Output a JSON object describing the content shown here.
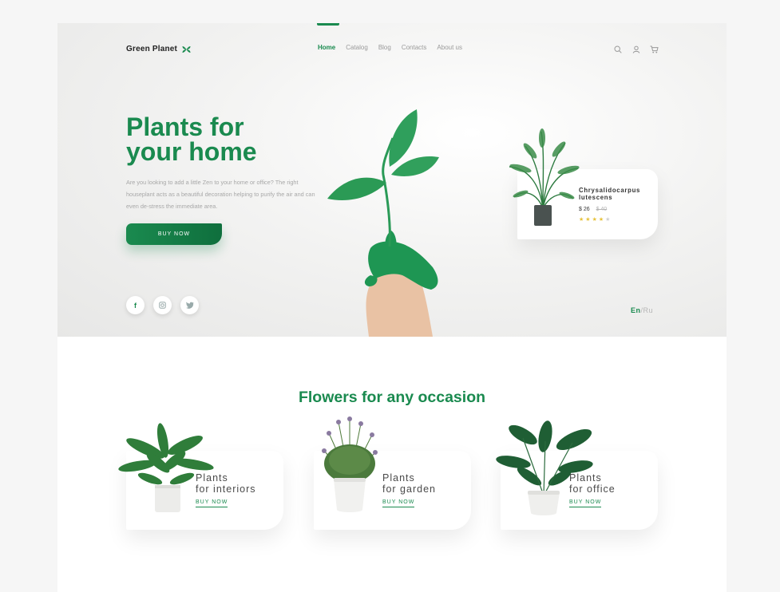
{
  "brand": {
    "name": "Green Planet",
    "accent": "#1a8a4f"
  },
  "nav": {
    "items": [
      {
        "label": "Home",
        "active": true
      },
      {
        "label": "Catalog",
        "active": false
      },
      {
        "label": "Blog",
        "active": false
      },
      {
        "label": "Contacts",
        "active": false
      },
      {
        "label": "About us",
        "active": false
      }
    ]
  },
  "header_icons": [
    "search-icon",
    "user-icon",
    "cart-icon"
  ],
  "hero": {
    "title_line1": "Plants for",
    "title_line2": "your home",
    "description": "Are you looking to add a little Zen to your home or office? The right houseplant acts as a beautiful decoration helping to purify the air and can even de-stress the immediate area.",
    "cta": "BUY NOW"
  },
  "socials": [
    {
      "icon": "facebook-icon",
      "glyph": "f"
    },
    {
      "icon": "instagram-icon",
      "glyph": ""
    },
    {
      "icon": "twitter-icon",
      "glyph": ""
    }
  ],
  "language": {
    "en": "En",
    "separator": "/",
    "ru": "Ru",
    "active": "En"
  },
  "featured_product": {
    "name": "Chrysalidocarpus lutescens",
    "price": "$ 26",
    "old_price": "$ 40",
    "rating": 4,
    "rating_max": 5
  },
  "occasions": {
    "title": "Flowers for any occasion",
    "items": [
      {
        "line1": "Plants",
        "line2": "for interiors",
        "cta": "BUY NOW"
      },
      {
        "line1": "Plants",
        "line2": "for garden",
        "cta": "BUY NOW"
      },
      {
        "line1": "Plants",
        "line2": "for office",
        "cta": "BUY NOW"
      }
    ]
  }
}
